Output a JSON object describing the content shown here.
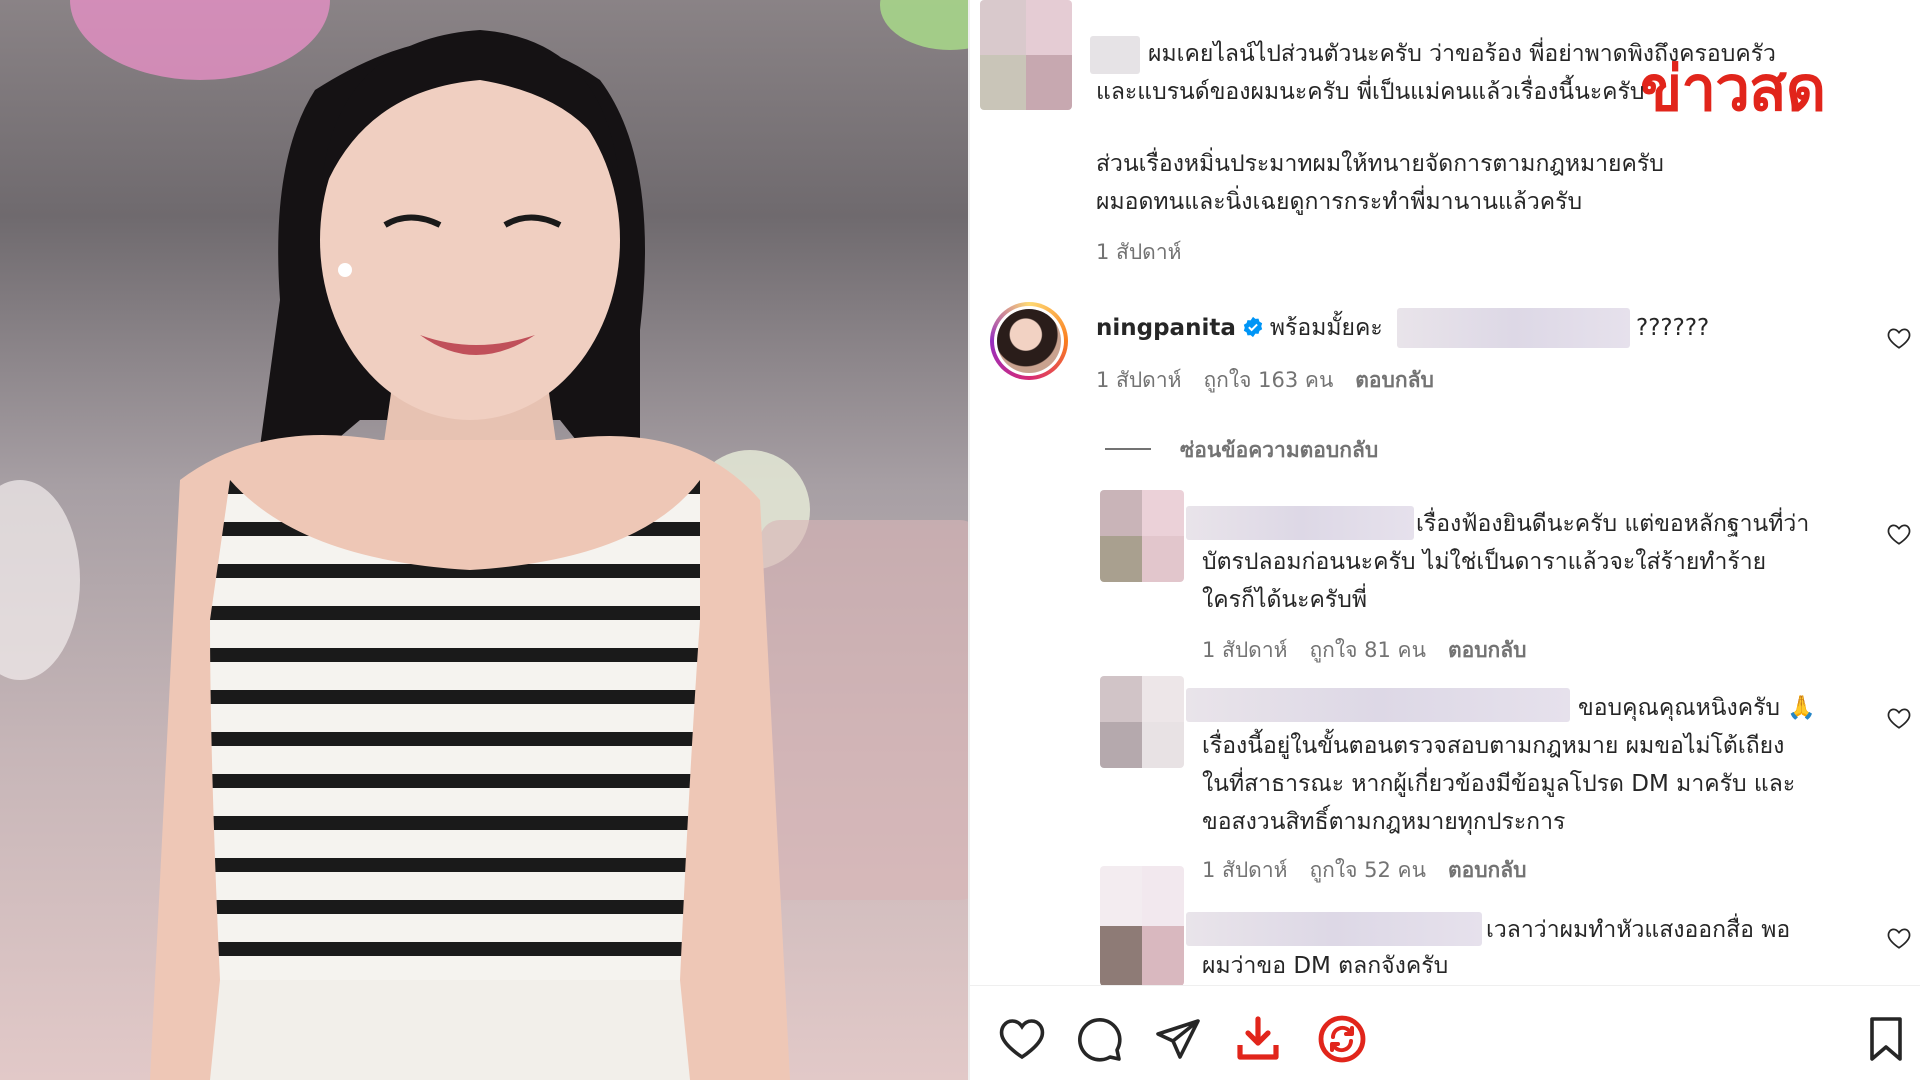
{
  "brand": {
    "logo_text": "ข่าวสด",
    "color": "#e1251b"
  },
  "post": {
    "caption_top": {
      "lines": [
        "ผมเคยไลน์ไปส่วนตัวนะครับ ว่าขอร้อง พี่อย่าพาดพิงถึงครอบครัว",
        "และแบรนด์ของผมนะครับ พี่เป็นแม่คนแล้วเรื่องนี้นะครับ",
        "ส่วนเรื่องหมิ่นประมาทผมให้ทนายจัดการตามกฎหมายครับ",
        "ผมอดทนและนิ่งเฉยดูการกระทำพี่มานานแล้วครับ"
      ],
      "time": "1 สัปดาห์"
    }
  },
  "comments": [
    {
      "username": "ningpanita",
      "verified": true,
      "text": "พร้อมมั้ยคะ",
      "suffix": "??????",
      "time": "1 สัปดาห์",
      "likes": "ถูกใจ 163 คน",
      "reply": "ตอบกลับ"
    }
  ],
  "hide_replies_label": "ซ่อนข้อความตอบกลับ",
  "replies": [
    {
      "lines": [
        "เรื่องฟ้องยินดีนะครับ แต่ขอหลักฐานที่ว่า",
        "บัตรปลอมก่อนนะครับ ไม่ใช่เป็นดาราแล้วจะใส่ร้ายทำร้าย",
        "ใครก็ได้นะครับพี่"
      ],
      "time": "1 สัปดาห์",
      "likes": "ถูกใจ 81 คน",
      "reply": "ตอบกลับ"
    },
    {
      "lines": [
        "ขอบคุณคุณหนิงครับ 🙏",
        "เรื่องนี้อยู่ในขั้นตอนตรวจสอบตามกฎหมาย ผมขอไม่โต้เถียง",
        "ในที่สาธารณะ หากผู้เกี่ยวข้องมีข้อมูลโปรด DM มาครับ และ",
        "ขอสงวนสิทธิ์ตามกฎหมายทุกประการ"
      ],
      "time": "1 สัปดาห์",
      "likes": "ถูกใจ 52 คน",
      "reply": "ตอบกลับ"
    },
    {
      "lines": [
        "เวลาว่าผมทำหัวแสงออกสื่อ พอ",
        "ผมว่าขอ DM ตลกจังครับ"
      ]
    }
  ],
  "colors": {
    "text": "#262626",
    "muted": "#737373",
    "verified": "#0095f6",
    "accent_red": "#e1251b"
  },
  "actions": [
    "heart-icon",
    "comment-icon",
    "share-icon",
    "download-icon",
    "repost-icon",
    "bookmark-icon"
  ]
}
